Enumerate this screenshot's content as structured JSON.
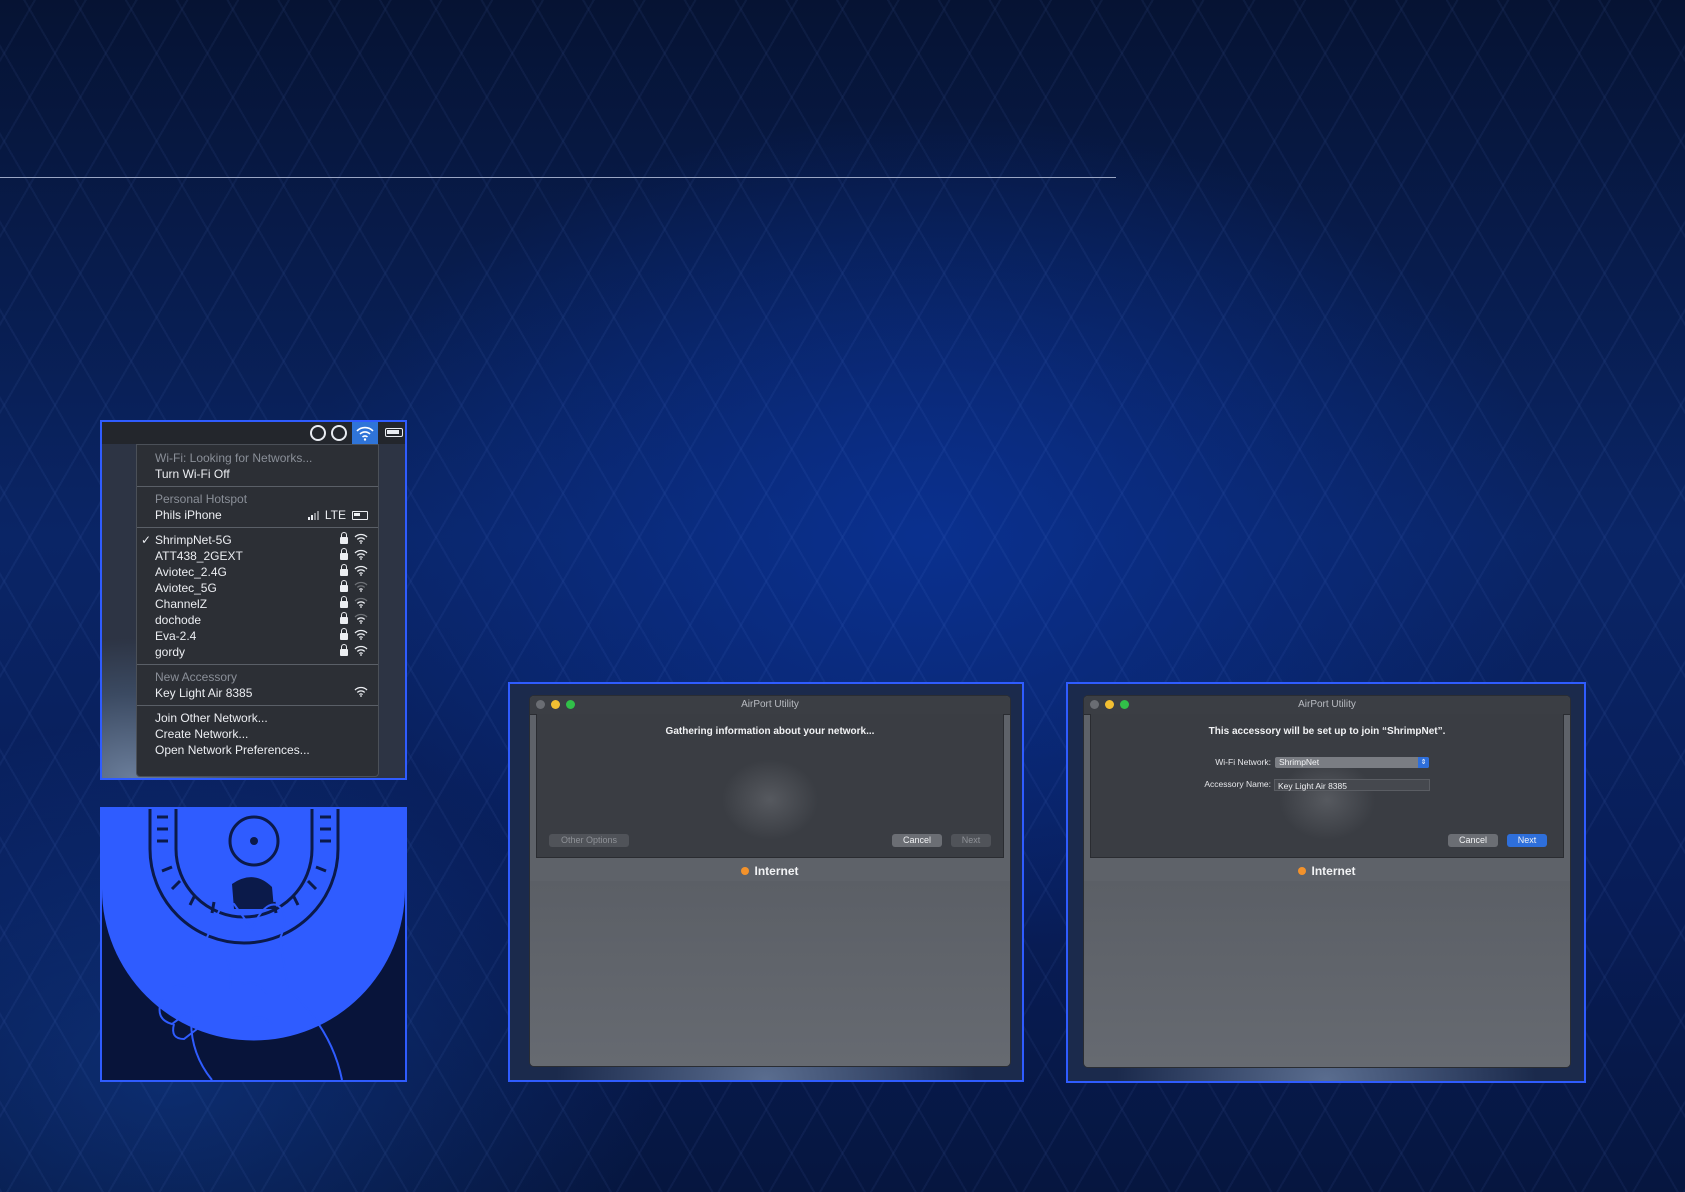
{
  "wifi_menu": {
    "header_status": "Wi-Fi: Looking for Networks...",
    "turn_off": "Turn Wi-Fi Off",
    "hotspot_header": "Personal Hotspot",
    "hotspot_name": "Phils iPhone",
    "hotspot_network": "LTE",
    "check_mark": "✓",
    "networks": [
      "ShrimpNet-5G",
      "ATT438_2GEXT",
      "Aviotec_2.4G",
      "Aviotec_5G",
      "ChannelZ",
      "dochode",
      "Eva-2.4",
      "gordy"
    ],
    "selected_network": "ShrimpNet-5G",
    "accessory_header": "New Accessory",
    "accessory_name": "Key Light Air 8385",
    "join_other": "Join Other Network...",
    "create_network": "Create Network...",
    "open_prefs": "Open Network Preferences..."
  },
  "airport_gathering": {
    "window_title": "AirPort Utility",
    "message": "Gathering information about your network...",
    "other_options": "Other Options",
    "cancel": "Cancel",
    "next": "Next",
    "internet": "Internet"
  },
  "airport_setup": {
    "window_title": "AirPort Utility",
    "message": "This accessory will be set up to join “ShrimpNet”.",
    "wifi_label": "Wi-Fi Network:",
    "wifi_value": "ShrimpNet",
    "name_label": "Accessory Name:",
    "name_value": "Key Light Air 8385",
    "cancel": "Cancel",
    "next": "Next",
    "internet": "Internet"
  },
  "colors": {
    "accent_blue": "#2f5cff",
    "internet_dot": "#f3922b",
    "next_button": "#2e6fdb"
  }
}
